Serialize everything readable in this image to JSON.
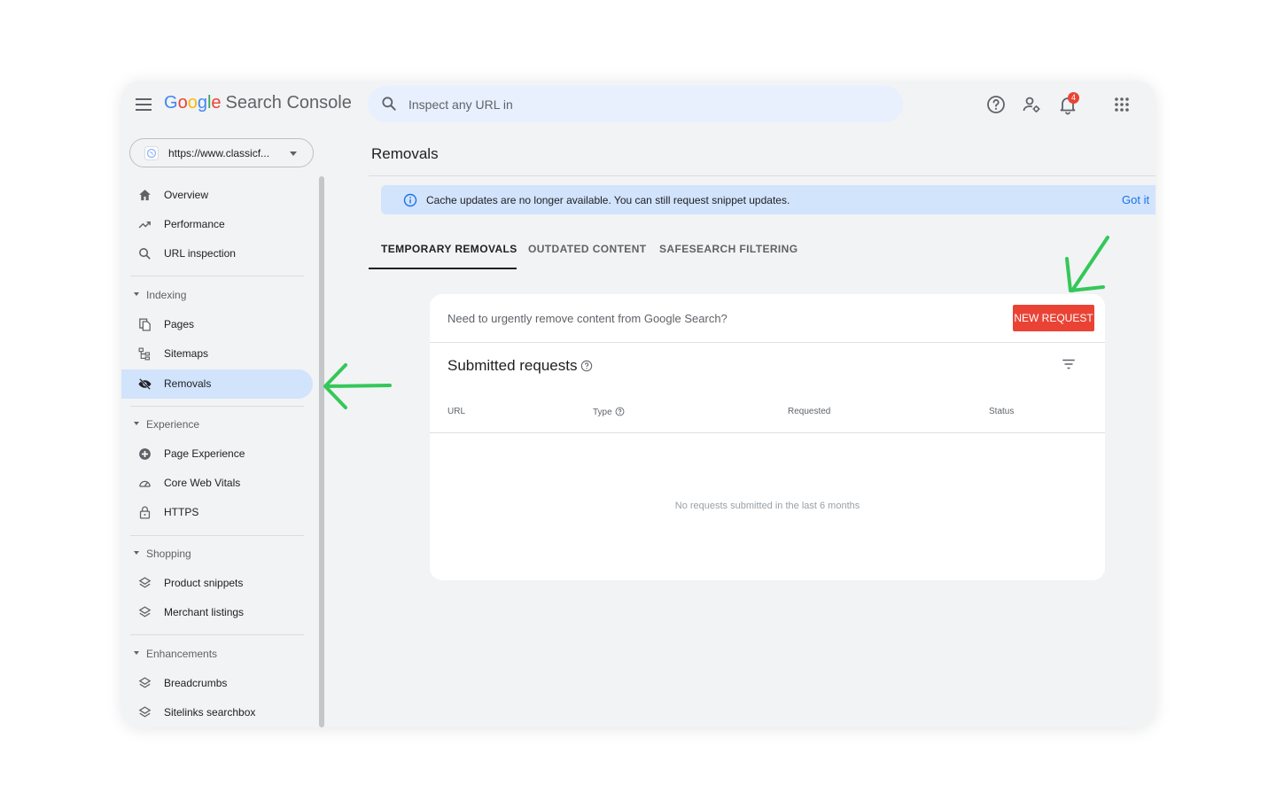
{
  "header": {
    "logo_letters": [
      "G",
      "o",
      "o",
      "g",
      "l",
      "e"
    ],
    "logo_product": "Search Console",
    "search_placeholder": "Inspect any URL in",
    "notification_count": "4",
    "icons": [
      "menu-icon",
      "search-icon",
      "help-icon",
      "user-settings-icon",
      "bell-icon",
      "apps-grid-icon"
    ]
  },
  "property": {
    "url": "https://www.classicf...",
    "icon": "globe-icon"
  },
  "sidebar": {
    "top_items": [
      {
        "label": "Overview",
        "icon": "home-icon"
      },
      {
        "label": "Performance",
        "icon": "trending-icon"
      },
      {
        "label": "URL inspection",
        "icon": "search-icon"
      }
    ],
    "sections": [
      {
        "title": "Indexing",
        "items": [
          {
            "label": "Pages",
            "icon": "pages-icon"
          },
          {
            "label": "Sitemaps",
            "icon": "sitemap-icon"
          },
          {
            "label": "Removals",
            "icon": "eye-off-icon",
            "active": true
          }
        ]
      },
      {
        "title": "Experience",
        "items": [
          {
            "label": "Page Experience",
            "icon": "plus-circle-icon"
          },
          {
            "label": "Core Web Vitals",
            "icon": "gauge-icon"
          },
          {
            "label": "HTTPS",
            "icon": "lock-icon"
          }
        ]
      },
      {
        "title": "Shopping",
        "items": [
          {
            "label": "Product snippets",
            "icon": "layers-icon"
          },
          {
            "label": "Merchant listings",
            "icon": "layers-icon"
          }
        ]
      },
      {
        "title": "Enhancements",
        "items": [
          {
            "label": "Breadcrumbs",
            "icon": "layers-icon"
          },
          {
            "label": "Sitelinks searchbox",
            "icon": "layers-icon"
          }
        ]
      }
    ]
  },
  "main": {
    "title": "Removals",
    "banner": {
      "text": "Cache updates are no longer available. You can still request snippet updates.",
      "action": "Got it",
      "icon": "info-icon"
    },
    "tabs": [
      {
        "label": "TEMPORARY REMOVALS",
        "active": true
      },
      {
        "label": "OUTDATED CONTENT",
        "active": false
      },
      {
        "label": "SAFESEARCH FILTERING",
        "active": false
      }
    ],
    "card": {
      "prompt": "Need to urgently remove content from Google Search?",
      "new_request": "NEW REQUEST",
      "subtitle": "Submitted requests",
      "columns": [
        "URL",
        "Type",
        "Requested",
        "Status"
      ],
      "empty_message": "No requests submitted in the last 6 months"
    }
  },
  "colors": {
    "accent_red": "#ea4335",
    "active_blue": "#d2e3fc",
    "banner_blue": "#d2e3fc",
    "link_blue": "#1a73e8",
    "annotation_green": "#34c759"
  }
}
